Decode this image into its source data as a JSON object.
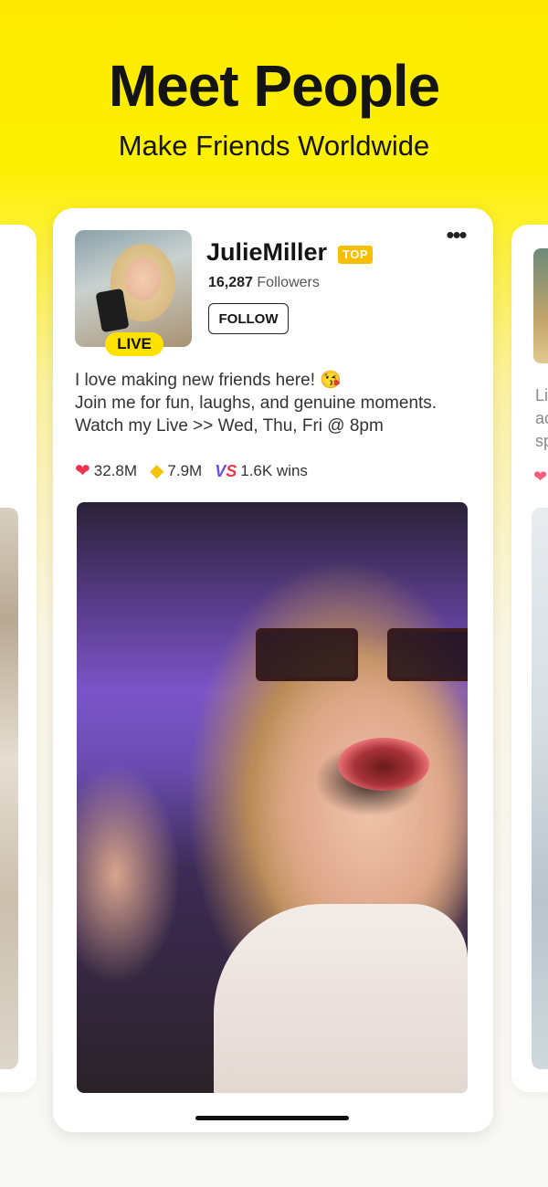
{
  "header": {
    "title": "Meet People",
    "subtitle": "Make Friends Worldwide"
  },
  "profile": {
    "username": "JulieMiller",
    "badge": "TOP",
    "live_label": "LIVE",
    "followers_count": "16,287",
    "followers_label": "Followers",
    "follow_button": "FOLLOW",
    "bio_lines": [
      "I love making new friends here! 😘",
      "Join me for fun, laughs, and genuine moments.",
      "Watch my Live >> Wed, Thu, Fri @ 8pm"
    ],
    "stats": {
      "likes": "32.8M",
      "diamonds": "7.9M",
      "wins": "1.6K wins"
    }
  },
  "side_card_right": {
    "peek_text": "Li\nac\nsp"
  },
  "colors": {
    "brand_yellow": "#fdea00",
    "top_badge": "#f6bf00",
    "live_badge": "#ffe100",
    "heart": "#f0334d"
  },
  "icons": [
    "more-options-icon",
    "heart-icon",
    "diamond-icon",
    "versus-icon"
  ]
}
